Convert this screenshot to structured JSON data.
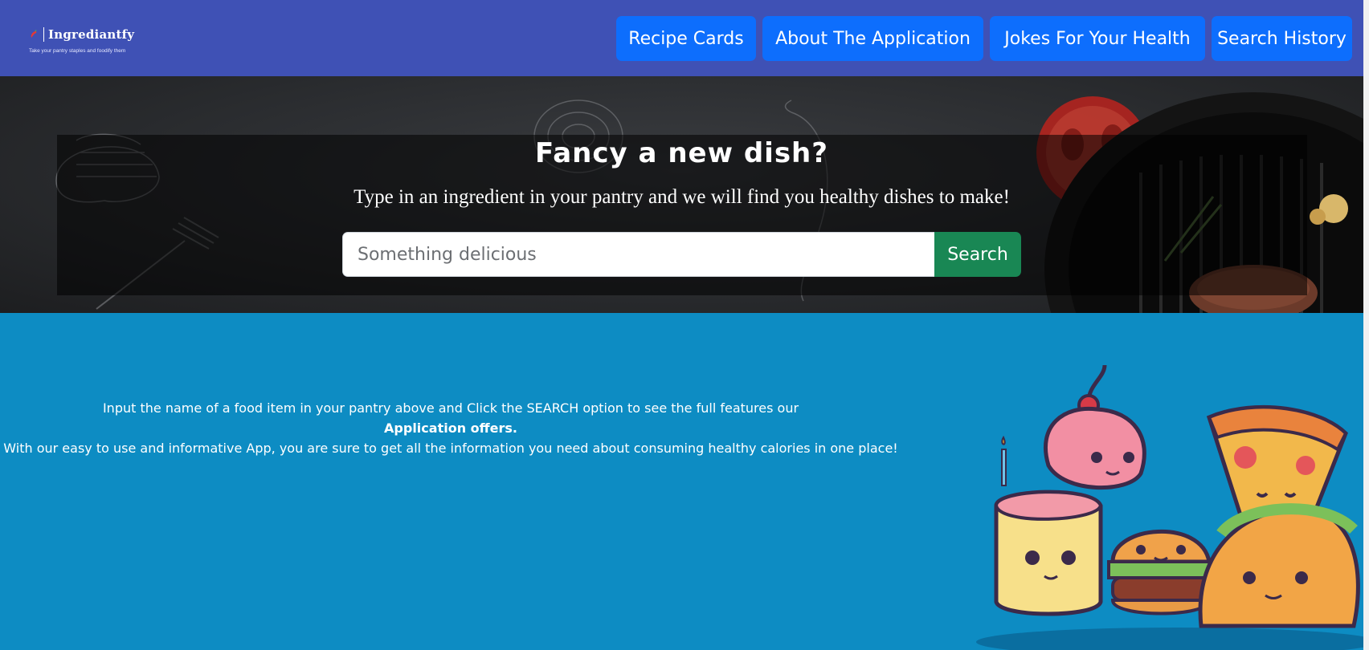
{
  "brand": {
    "name": "Ingrediantfy",
    "tagline": "Take your pantry staples and foodify them",
    "logo_icon": "chili-pepper-icon"
  },
  "nav": {
    "items": [
      {
        "label": "Recipe Cards"
      },
      {
        "label": "About The Application"
      },
      {
        "label": "Jokes For Your Health"
      },
      {
        "label": "Search History"
      }
    ]
  },
  "hero": {
    "title": "Fancy a new dish?",
    "subtitle": "Type in an ingredient in your pantry and we will find you healthy dishes to make!",
    "search": {
      "placeholder": "Something delicious",
      "value": "",
      "button_label": "Search"
    }
  },
  "info": {
    "line1": "Input the name of a food item in your pantry above and Click the SEARCH option to see the full features our",
    "line2": "Application offers.",
    "line3": "With our easy to use and informative App, you are sure to get all the information you need about consuming healthy calories in one place!"
  },
  "colors": {
    "navbar": "#3f51b5",
    "nav_button": "#0d6efd",
    "search_button": "#198754",
    "section_bg": "#0d8cc3"
  }
}
